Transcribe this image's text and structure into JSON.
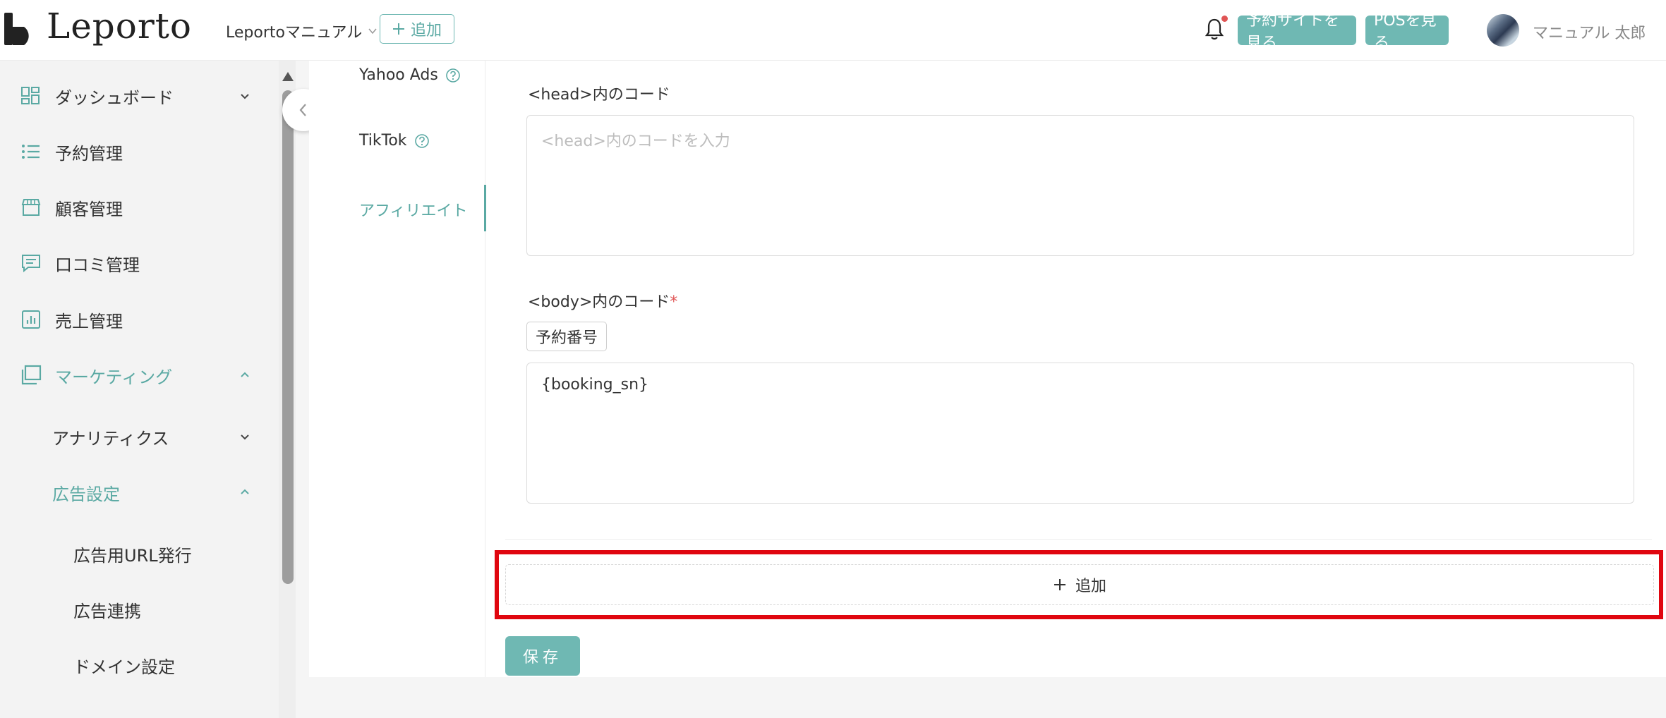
{
  "header": {
    "logo_text": "Leporto",
    "store_name": "Leportoマニュアル",
    "add_label": "追加",
    "view_site_label": "予約サイトを見る",
    "view_pos_label": "POSを見る",
    "user_name": "マニュアル 太郎",
    "notification_badge": true
  },
  "sidebar": {
    "items": [
      {
        "label": "ダッシュボード",
        "icon": "dashboard-icon",
        "expanded": false
      },
      {
        "label": "予約管理",
        "icon": "list-icon"
      },
      {
        "label": "顧客管理",
        "icon": "store-icon"
      },
      {
        "label": "口コミ管理",
        "icon": "comment-icon"
      },
      {
        "label": "売上管理",
        "icon": "chart-icon"
      },
      {
        "label": "マーケティング",
        "icon": "window-icon",
        "expanded": true,
        "active": true
      }
    ],
    "subitems": [
      {
        "label": "アナリティクス",
        "expanded": false
      },
      {
        "label": "広告設定",
        "expanded": true,
        "active": true
      }
    ],
    "subsubitems": [
      {
        "label": "広告用URL発行"
      },
      {
        "label": "広告連携"
      },
      {
        "label": "ドメイン設定"
      }
    ]
  },
  "subnav": {
    "items": [
      {
        "label": "Yahoo Ads",
        "help": true
      },
      {
        "label": "TikTok",
        "help": true
      },
      {
        "label": "アフィリエイト",
        "active": true
      }
    ]
  },
  "form": {
    "head_label": "<head>内のコード",
    "head_placeholder": "<head>内のコードを入力",
    "body_label": "<body>内のコード",
    "body_required_mark": "*",
    "tag_button_label": "予約番号",
    "body_value": "{booking_sn}",
    "add_button_label": "追加",
    "save_button_label": "保存"
  },
  "colors": {
    "accent": "#6fb8b3",
    "highlight": "#e0060f",
    "notification": "#e05555"
  }
}
